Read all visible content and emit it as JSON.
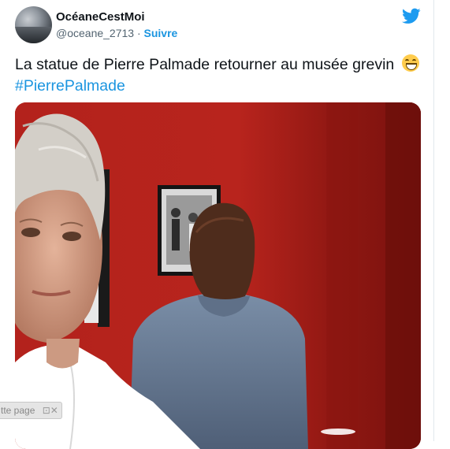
{
  "tweet": {
    "author": {
      "display_name": "OcéaneCestMoi",
      "handle": "@oceane_2713",
      "separator": "·",
      "follow_label": "Suivre"
    },
    "text": "La statue de Pierre Palmade retourner au musée grevin",
    "emoji": "grinning-squinting-face",
    "hashtag": "#PierrePalmade",
    "brand_color": "#1d9bf0",
    "link_color": "#1b95e0",
    "photo": {
      "subject": "wax figure of a woman in white shirt and a man in blue jacket in front of red wall"
    }
  },
  "overlay": {
    "translate_label": "tte page",
    "extra_glyphs": "⊡✕"
  }
}
